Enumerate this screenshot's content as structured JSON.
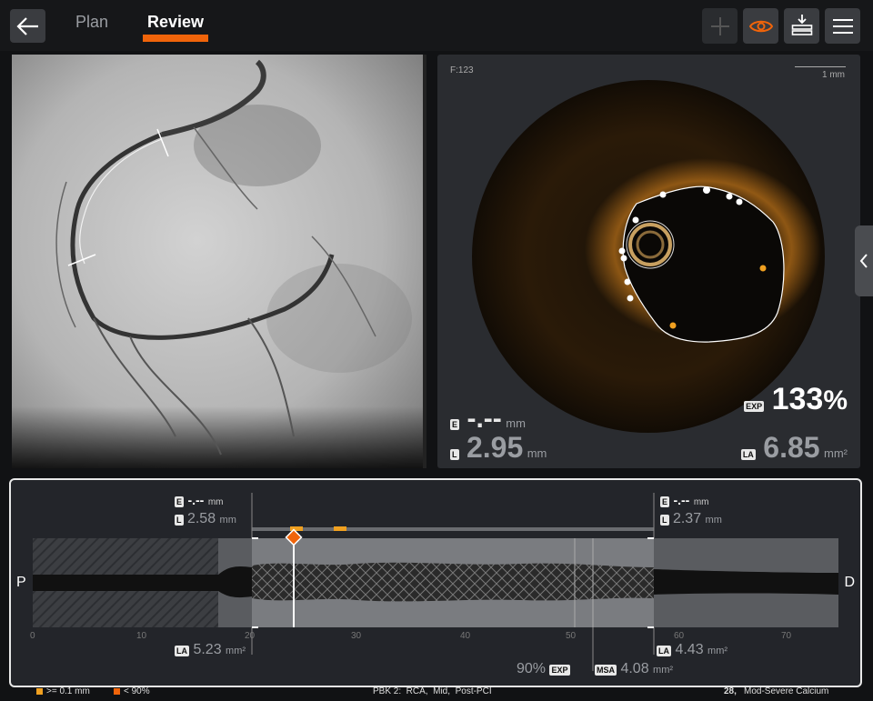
{
  "header": {
    "tabs": [
      {
        "label": "Plan"
      },
      {
        "label": "Review"
      }
    ],
    "active_tab": "Review",
    "accent_color": "#f0640a",
    "buttons": [
      "back-arrow-icon",
      "add-icon",
      "eye-icon",
      "download-stack-icon",
      "menu-icon"
    ]
  },
  "oct_view": {
    "frame_label": "F:123",
    "scale_label": "1 mm",
    "e_badge": "E",
    "e_value": "-.--",
    "e_unit": "mm",
    "l_badge": "L",
    "l_value": "2.95",
    "l_unit": "mm",
    "exp_badge": "EXP",
    "exp_value": "133",
    "exp_unit": "%",
    "la_badge": "LA",
    "la_value": "6.85",
    "la_unit": "mm²"
  },
  "longitudinal": {
    "left_label": "P",
    "right_label": "D",
    "proximal": {
      "e_badge": "E",
      "e_value": "-.--",
      "e_unit": "mm",
      "l_badge": "L",
      "l_value": "2.58",
      "l_unit": "mm",
      "la_badge": "LA",
      "la_value": "5.23",
      "la_unit": "mm²"
    },
    "distal": {
      "e_badge": "E",
      "e_value": "-.--",
      "e_unit": "mm",
      "l_badge": "L",
      "l_value": "2.37",
      "l_unit": "mm",
      "la_badge": "LA",
      "la_value": "4.43",
      "la_unit": "mm²"
    },
    "exp_value": "90%",
    "exp_badge": "EXP",
    "msa_badge": "MSA",
    "msa_value": "4.08",
    "msa_unit": "mm²",
    "axis_ticks": [
      "0",
      "10",
      "20",
      "30",
      "40",
      "50",
      "60",
      "70"
    ]
  },
  "status_bar": {
    "legend1": ">= 0.1 mm",
    "legend2": "< 90%",
    "legend1_color": "#f0a020",
    "legend2_color": "#f0640a",
    "center": "PBK 2:  RCA,  Mid,  Post-PCI",
    "right_number": "28,",
    "right_text": "Mod-Severe Calcium"
  }
}
